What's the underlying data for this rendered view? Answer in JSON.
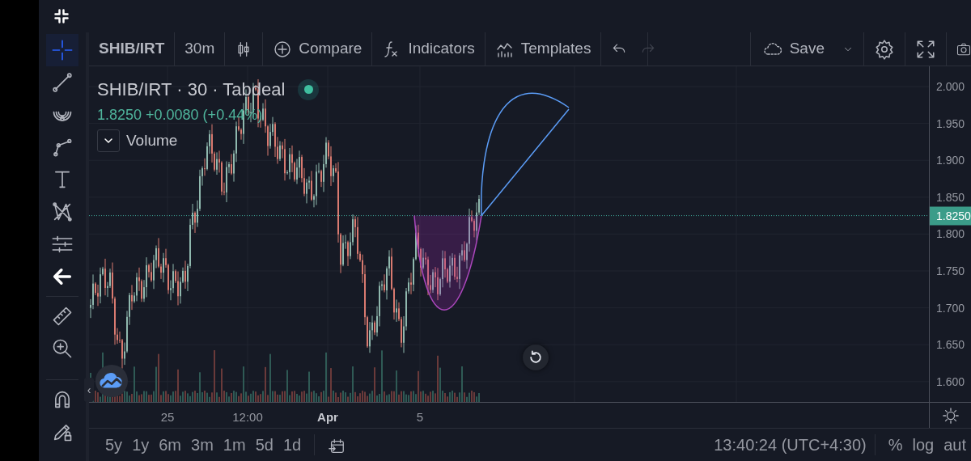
{
  "tools": [
    {
      "kind": "crosshair",
      "selected": true
    },
    {
      "kind": "trendline",
      "selected": false
    },
    {
      "kind": "pitchfan",
      "selected": false
    },
    {
      "kind": "path",
      "selected": false
    },
    {
      "kind": "text",
      "selected": false
    },
    {
      "kind": "pattern",
      "selected": false
    },
    {
      "kind": "projection",
      "selected": false
    },
    {
      "kind": "arrow",
      "selected": false
    },
    {
      "kind": "ruler",
      "selected": false
    },
    {
      "kind": "zoom",
      "selected": false
    },
    {
      "kind": "magnet",
      "selected": false
    },
    {
      "kind": "lockdraw",
      "selected": false
    }
  ],
  "toolbar": {
    "symbol": "SHIB/IRT",
    "interval": "30m",
    "items": [
      {
        "kind": "compare",
        "label": "Compare"
      },
      {
        "kind": "indicators",
        "label": "Indicators"
      },
      {
        "kind": "templates",
        "label": "Templates"
      }
    ],
    "undo": {
      "disabled": false
    },
    "redo": {
      "disabled": true
    },
    "save": "Save"
  },
  "legend": {
    "parts": [
      "SHIB/IRT",
      "30",
      "Tabdeal"
    ],
    "separator": "·",
    "quote": "1.8250 +0.0080 (+0.44%)",
    "volume": "Volume"
  },
  "price_axis": {
    "labels": [
      "2.000",
      "1.950",
      "1.900",
      "1.850",
      "1.800",
      "1.750",
      "1.700",
      "1.650",
      "1.600"
    ],
    "current": "1.8250"
  },
  "time_axis": {
    "labels": [
      {
        "text": "25",
        "bold": false
      },
      {
        "text": "12:00",
        "bold": false
      },
      {
        "text": "Apr",
        "bold": true
      },
      {
        "text": "5",
        "bold": false
      }
    ]
  },
  "collapse": "‹",
  "ranges": [
    "5y",
    "1y",
    "6m",
    "3m",
    "1m",
    "5d",
    "1d"
  ],
  "clock": "13:40:24 (UTC+4:30)",
  "scale_buttons": [
    "%",
    "log",
    "aut"
  ]
}
